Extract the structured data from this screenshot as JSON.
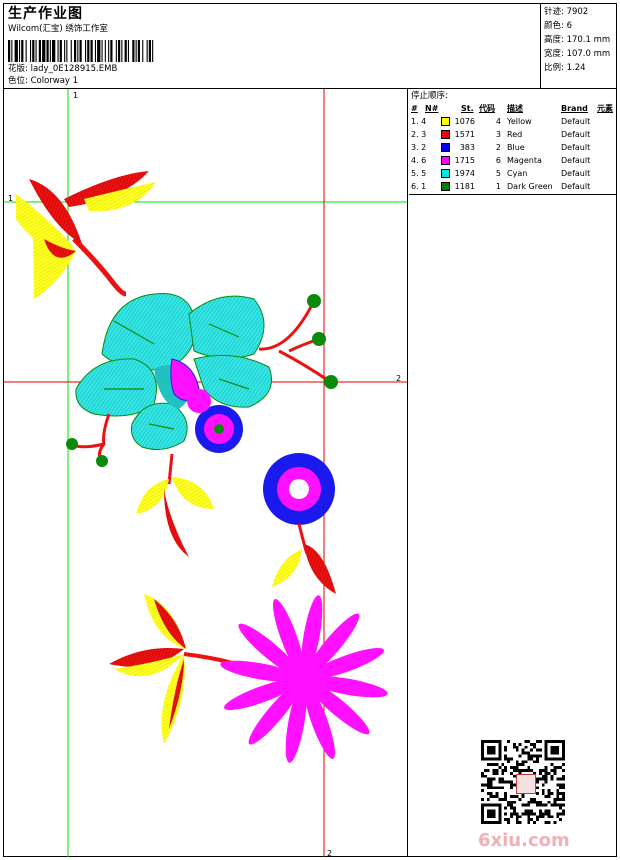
{
  "header": {
    "title": "生产作业图",
    "subtitle": "Wilcom(汇宝) 绣饰工作室",
    "design_file_label": "花版:",
    "design_file": "lady_0E128915.EMB",
    "colorway_label": "色位:",
    "colorway": "Colorway 1"
  },
  "stats": [
    {
      "label": "针迹:",
      "value": "7902"
    },
    {
      "label": "颜色:",
      "value": "6"
    },
    {
      "label": "高度:",
      "value": "170.1 mm"
    },
    {
      "label": "宽度:",
      "value": "107.0 mm"
    },
    {
      "label": "比例:",
      "value": "1.24"
    }
  ],
  "guides": {
    "green_v": "1",
    "green_h": "1",
    "red_h": "2",
    "red_v": "2"
  },
  "color_table": {
    "title": "停止顺序:",
    "headers": {
      "num": "#",
      "n": "N#",
      "st": "St.",
      "code": "代码",
      "desc": "描述",
      "brand": "Brand",
      "el": "元素"
    },
    "rows": [
      {
        "num": "1. 4",
        "st": "1076",
        "code": "4",
        "desc": "Yellow",
        "brand": "Default",
        "color": "#ffff00"
      },
      {
        "num": "2. 3",
        "st": "1571",
        "code": "3",
        "desc": "Red",
        "brand": "Default",
        "color": "#ee0000"
      },
      {
        "num": "3. 2",
        "st": "383",
        "code": "2",
        "desc": "Blue",
        "brand": "Default",
        "color": "#0000ee"
      },
      {
        "num": "4. 6",
        "st": "1715",
        "code": "6",
        "desc": "Magenta",
        "brand": "Default",
        "color": "#ff00ff"
      },
      {
        "num": "5. 5",
        "st": "1974",
        "code": "5",
        "desc": "Cyan",
        "brand": "Default",
        "color": "#00e8e8"
      },
      {
        "num": "6. 1",
        "st": "1181",
        "code": "1",
        "desc": "Dark Green",
        "brand": "Default",
        "color": "#008000"
      }
    ]
  },
  "watermark": {
    "site": "6xiu.com"
  },
  "colors": {
    "guide_green": "#00dd00",
    "guide_red": "#dd0000",
    "yellow": "#ffff00",
    "red": "#ee1111",
    "blue": "#1a1aee",
    "magenta": "#ff11ff",
    "cyan": "#33e6e6",
    "green": "#0a8a0a"
  }
}
